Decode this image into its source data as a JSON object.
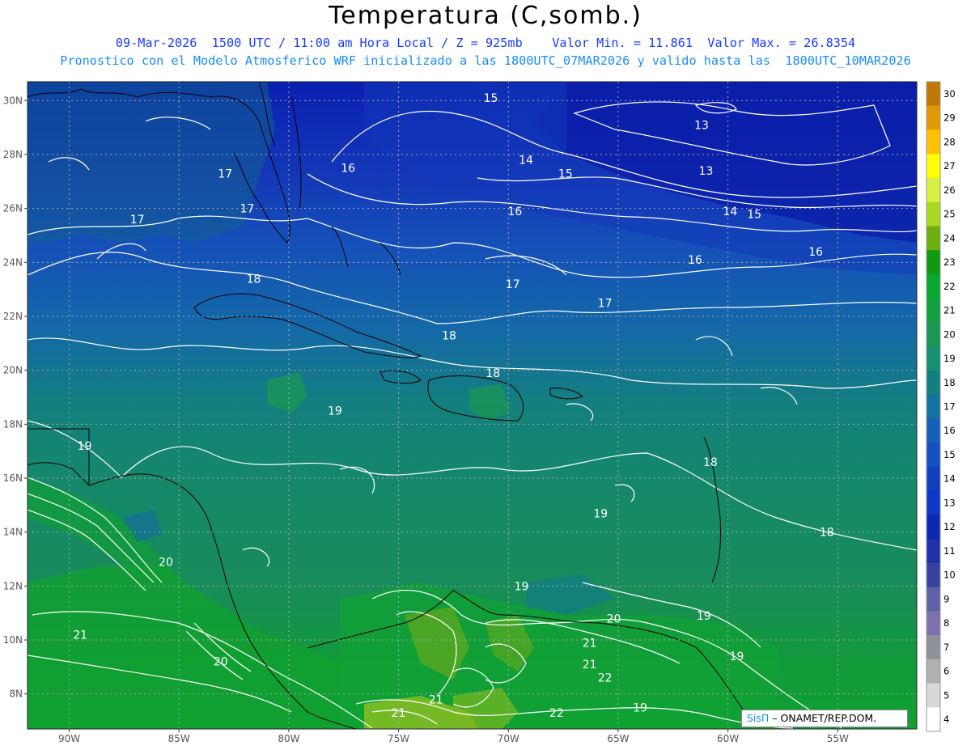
{
  "title": "Temperatura (C,somb.)",
  "subtitle_line1": "09-Mar-2026  1500 UTC / 11:00 am Hora Local / Z = 925mb    Valor Min. = 11.861  Valor Max. = 26.8354",
  "subtitle_line2": "Pronostico con el Modelo Atmosferico WRF inicializado a las 1800UTC_07MAR2026 y valido hasta las  1800UTC_10MAR2026",
  "credit": {
    "logo": "SisΠ",
    "text": " – ONAMET/REP.DOM."
  },
  "axes": {
    "lat_labels": [
      "30N",
      "28N",
      "26N",
      "24N",
      "22N",
      "20N",
      "18N",
      "16N",
      "14N",
      "12N",
      "10N",
      "8N"
    ],
    "lon_labels": [
      "90W",
      "85W",
      "80W",
      "75W",
      "70W",
      "65W",
      "60W",
      "55W"
    ]
  },
  "colorbar": {
    "ticks": [
      "30",
      "29",
      "28",
      "27",
      "26",
      "25",
      "24",
      "23",
      "22",
      "21",
      "20",
      "19",
      "18",
      "17",
      "16",
      "15",
      "14",
      "13",
      "12",
      "11",
      "10",
      "9",
      "8",
      "7",
      "6",
      "5",
      "4"
    ],
    "colors": [
      "#c07800",
      "#e09a00",
      "#ffc000",
      "#ffff00",
      "#d8f040",
      "#a8d820",
      "#6cb010",
      "#109a10",
      "#08a830",
      "#10a040",
      "#189850",
      "#159070",
      "#138080",
      "#1472a0",
      "#1560b8",
      "#1450c0",
      "#1040c0",
      "#1038c8",
      "#0a28b0",
      "#2030a8",
      "#3840a0",
      "#6060a8",
      "#8070b0",
      "#909098",
      "#b0b0b0",
      "#d8d8d8",
      "#ffffff"
    ]
  },
  "contour_labels": [
    {
      "text": "15",
      "lat": 30.1,
      "lon": -70.8
    },
    {
      "text": "13",
      "lat": 29.1,
      "lon": -61.2
    },
    {
      "text": "14",
      "lat": 27.8,
      "lon": -69.2
    },
    {
      "text": "16",
      "lat": 27.5,
      "lon": -77.3
    },
    {
      "text": "17",
      "lat": 27.3,
      "lon": -82.9
    },
    {
      "text": "15",
      "lat": 27.3,
      "lon": -67.4
    },
    {
      "text": "13",
      "lat": 27.4,
      "lon": -61.0
    },
    {
      "text": "17",
      "lat": 26.0,
      "lon": -81.9
    },
    {
      "text": "16",
      "lat": 25.9,
      "lon": -69.7
    },
    {
      "text": "14",
      "lat": 25.9,
      "lon": -59.9
    },
    {
      "text": "15",
      "lat": 25.8,
      "lon": -58.8
    },
    {
      "text": "17",
      "lat": 25.6,
      "lon": -86.9
    },
    {
      "text": "16",
      "lat": 24.1,
      "lon": -61.5
    },
    {
      "text": "16",
      "lat": 24.4,
      "lon": -56.0
    },
    {
      "text": "18",
      "lat": 23.4,
      "lon": -81.6
    },
    {
      "text": "17",
      "lat": 23.2,
      "lon": -69.8
    },
    {
      "text": "17",
      "lat": 22.5,
      "lon": -65.6
    },
    {
      "text": "18",
      "lat": 21.3,
      "lon": -72.7
    },
    {
      "text": "18",
      "lat": 19.9,
      "lon": -70.7
    },
    {
      "text": "19",
      "lat": 18.5,
      "lon": -77.9
    },
    {
      "text": "19",
      "lat": 17.2,
      "lon": -89.3
    },
    {
      "text": "18",
      "lat": 16.6,
      "lon": -60.8
    },
    {
      "text": "19",
      "lat": 14.7,
      "lon": -65.8
    },
    {
      "text": "18",
      "lat": 14.0,
      "lon": -55.5
    },
    {
      "text": "20",
      "lat": 12.9,
      "lon": -85.6
    },
    {
      "text": "19",
      "lat": 12.0,
      "lon": -69.4
    },
    {
      "text": "20",
      "lat": 10.8,
      "lon": -65.2
    },
    {
      "text": "19",
      "lat": 10.9,
      "lon": -61.1
    },
    {
      "text": "21",
      "lat": 10.2,
      "lon": -89.5
    },
    {
      "text": "21",
      "lat": 9.9,
      "lon": -66.3
    },
    {
      "text": "19",
      "lat": 9.4,
      "lon": -59.6
    },
    {
      "text": "20",
      "lat": 9.2,
      "lon": -83.1
    },
    {
      "text": "21",
      "lat": 9.1,
      "lon": -66.3
    },
    {
      "text": "22",
      "lat": 8.6,
      "lon": -65.6
    },
    {
      "text": "21",
      "lat": 7.8,
      "lon": -73.3
    },
    {
      "text": "19",
      "lat": 7.5,
      "lon": -64.0
    },
    {
      "text": "21",
      "lat": 7.3,
      "lon": -75.0
    },
    {
      "text": "22",
      "lat": 7.3,
      "lon": -67.8
    }
  ]
}
